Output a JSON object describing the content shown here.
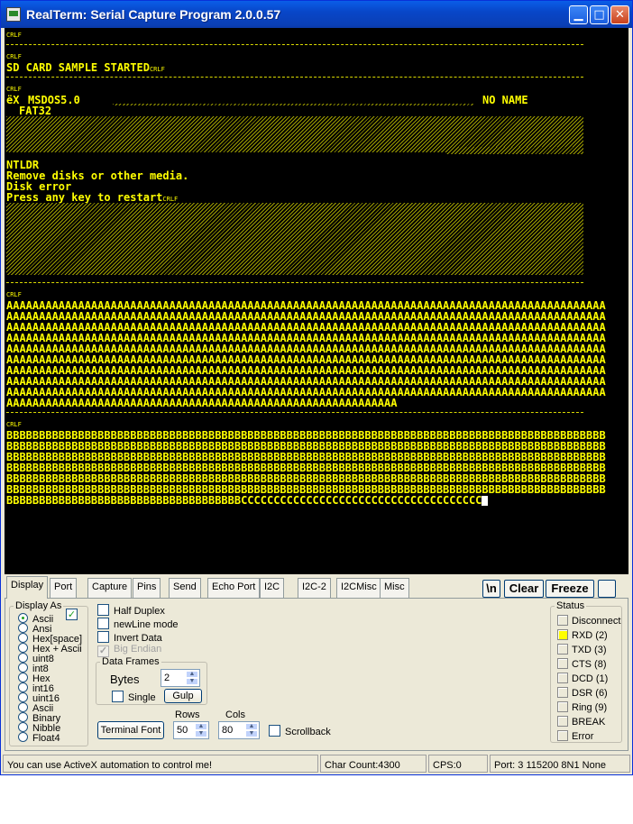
{
  "window": {
    "title": "RealTerm: Serial Capture Program 2.0.0.57"
  },
  "terminal": {
    "lines": [
      "SD CARD SAMPLE STARTED",
      "ëXMSDOS5.0",
      "FAT32",
      "NO NAME",
      "NTLDR",
      "Remove disks or other media.",
      "Disk error",
      "Press any key to restart"
    ],
    "crlf": "CRLF",
    "a_line": "AAAAAAAAAAAAAAAAAAAAAAAAAAAAAAAAAAAAAAAAAAAAAAAAAAAAAAAAAAAAAAAAAAAAAAAAAAAAAAAAAAAAAAAAAAAA",
    "a_last": "AAAAAAAAAAAAAAAAAAAAAAAAAAAAAAAAAAAAAAAAAAAAAAAAAAAAAAAAAAAA",
    "b_line": "BBBBBBBBBBBBBBBBBBBBBBBBBBBBBBBBBBBBBBBBBBBBBBBBBBBBBBBBBBBBBBBBBBBBBBBBBBBBBBBBBBBBBBBBBBBB",
    "b_last": "BBBBBBBBBBBBBBBBBBBBBBBBBBBBBBBBBBBBCCCCCCCCCCCCCCCCCCCCCCCCCCCCCCCCCCCCC",
    "a_count": 10,
    "b_count": 7
  },
  "tabs": [
    "Display",
    "Port",
    "Capture",
    "Pins",
    "Send",
    "Echo Port",
    "I2C",
    "I2C-2",
    "I2CMisc",
    "Misc"
  ],
  "toolbar": {
    "newline": "\\n",
    "clear": "Clear",
    "freeze": "Freeze"
  },
  "display_as": {
    "label": "Display As",
    "options": [
      "Ascii",
      "Ansi",
      "Hex[space]",
      "Hex + Ascii",
      "uint8",
      "int8",
      "Hex",
      "int16",
      "uint16",
      "Ascii",
      "Binary",
      "Nibble",
      "Float4"
    ],
    "selected": "Ascii"
  },
  "options": {
    "half_duplex": "Half Duplex",
    "newline_mode": "newLine mode",
    "invert_data": "Invert Data",
    "big_endian": "Big Endian"
  },
  "data_frames": {
    "label": "Data Frames",
    "bytes_label": "Bytes",
    "bytes_value": "2",
    "single": "Single",
    "gulp": "Gulp"
  },
  "terminal_font": "Terminal Font",
  "rows": {
    "label": "Rows",
    "value": "50"
  },
  "cols": {
    "label": "Cols",
    "value": "80"
  },
  "scrollback": "Scrollback",
  "status": {
    "label": "Status",
    "items": [
      "Disconnect",
      "RXD (2)",
      "TXD (3)",
      "CTS (8)",
      "DCD (1)",
      "DSR (6)",
      "Ring (9)",
      "BREAK",
      "Error"
    ],
    "lit": "RXD (2)"
  },
  "statusbar": {
    "message": "You can use ActiveX automation to control me!",
    "char_count": "Char Count:4300",
    "cps": "CPS:0",
    "port": "Port: 3 115200 8N1 None"
  }
}
